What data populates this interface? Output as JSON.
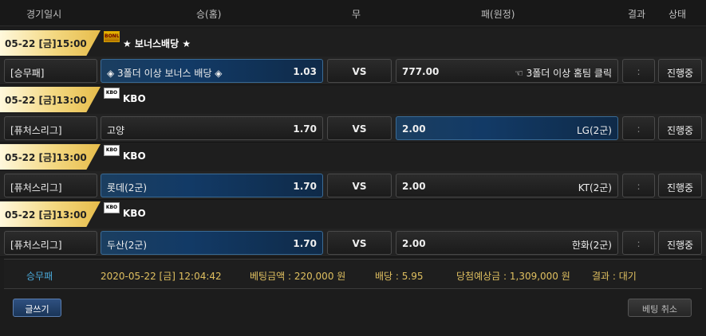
{
  "header": {
    "datetime": "경기일시",
    "home": "승(홈)",
    "draw": "무",
    "away": "패(원정)",
    "result": "결과",
    "status": "상태"
  },
  "groups": [
    {
      "date": "05-22 [금]15:00",
      "league_icon": "bonus-icon",
      "league": "★ 보너스배당 ★",
      "game": {
        "type": "[승무패]",
        "home": "◈ 3폴더 이상 보너스 배당 ◈",
        "home_odds": "1.03",
        "vs": "VS",
        "away_odds": "777.00",
        "away": "☜ 3폴더 이상 홈팀 클릭",
        "result": ":",
        "status": "진행중"
      }
    },
    {
      "date": "05-22 [금]13:00",
      "league_icon": "kbo-icon",
      "league": "KBO",
      "game": {
        "type": "[퓨처스리그]",
        "home": "고양",
        "home_odds": "1.70",
        "vs": "VS",
        "away_odds": "2.00",
        "away": "LG(2군)",
        "result": ":",
        "status": "진행중"
      }
    },
    {
      "date": "05-22 [금]13:00",
      "league_icon": "kbo-icon",
      "league": "KBO",
      "game": {
        "type": "[퓨처스리그]",
        "home": "롯데(2군)",
        "home_odds": "1.70",
        "vs": "VS",
        "away_odds": "2.00",
        "away": "KT(2군)",
        "result": ":",
        "status": "진행중"
      }
    },
    {
      "date": "05-22 [금]13:00",
      "league_icon": "kbo-icon",
      "league": "KBO",
      "game": {
        "type": "[퓨처스리그]",
        "home": "두산(2군)",
        "home_odds": "1.70",
        "vs": "VS",
        "away_odds": "2.00",
        "away": "한화(2군)",
        "result": ":",
        "status": "진행중"
      }
    }
  ],
  "summary": {
    "type": "승무패",
    "datetime": "2020-05-22 [금] 12:04:42",
    "bet_amount": "베팅금액 : 220,000 원",
    "odds": "배당 : 5.95",
    "expected_win": "당첨예상금 : 1,309,000 원",
    "result": "결과 : 대기"
  },
  "buttons": {
    "write": "글쓰기",
    "cancel": "베팅 취소"
  }
}
